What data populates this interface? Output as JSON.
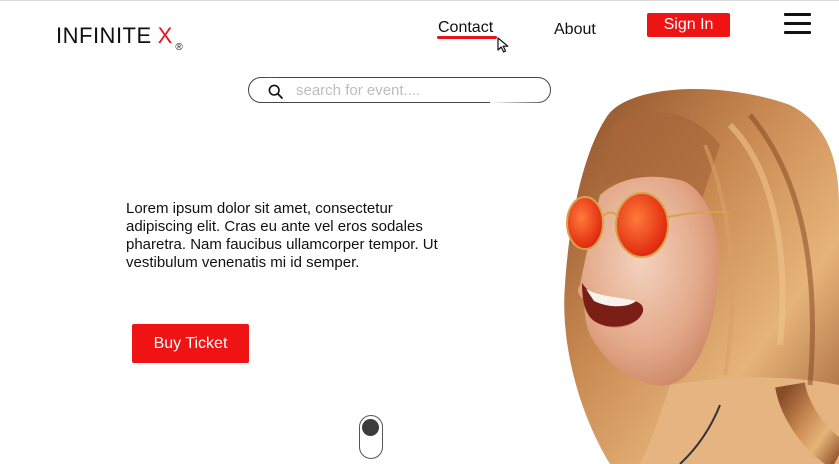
{
  "brand": {
    "name": "INFINITE",
    "x": "X",
    "reg": "®"
  },
  "nav": {
    "contact": "Contact",
    "about": "About",
    "signin": "Sign In"
  },
  "search": {
    "dots": "...",
    "placeholder": "search for event....",
    "value": ""
  },
  "hero": {
    "text": "Lorem ipsum dolor sit amet, consectetur adipiscing elit. Cras eu ante vel eros sodales pharetra. Nam faucibus ullamcorper tempor. Ut vestibulum venenatis mi id semper.",
    "buy_label": "Buy Ticket"
  },
  "icons": {
    "menu": "hamburger-menu-icon",
    "search": "search-icon",
    "cursor": "mouse-pointer-icon",
    "scroll": "scroll-indicator-icon"
  },
  "colors": {
    "accent": "#ef1313",
    "brand_x": "#e4141b",
    "text": "#111111"
  }
}
